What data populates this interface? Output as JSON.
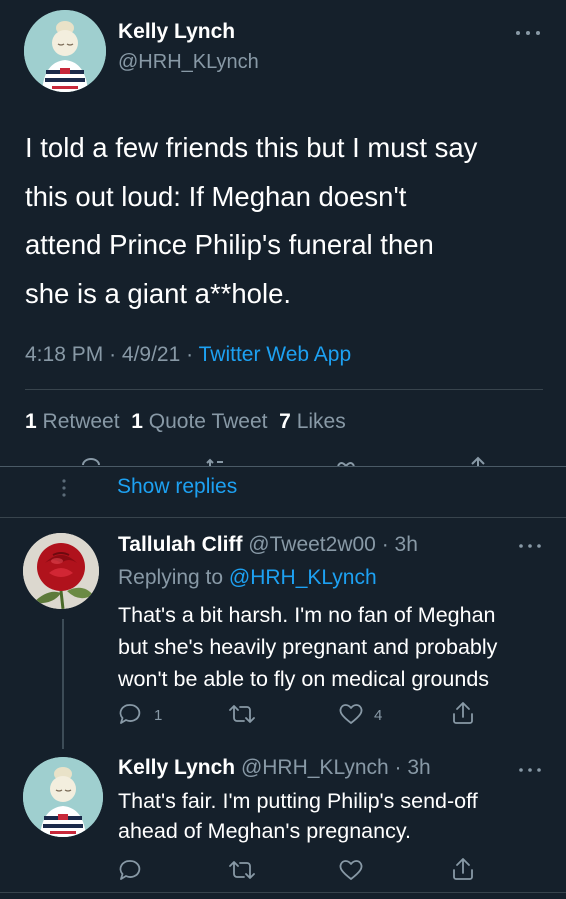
{
  "main_tweet": {
    "author_name": "Kelly Lynch",
    "author_handle": "@HRH_KLynch",
    "text_lines": [
      "I told a few friends this but I must say",
      "this out loud: If Meghan doesn't",
      "attend Prince Philip's funeral then",
      "she is a giant a**hole."
    ],
    "time": "4:18 PM",
    "date": "4/9/21",
    "separator": "·",
    "source": "Twitter Web App",
    "retweets_count": "1",
    "retweets_label": "Retweet",
    "quotes_count": "1",
    "quotes_label": "Quote Tweet",
    "likes_count": "7",
    "likes_label": "Likes"
  },
  "show_replies_label": "Show replies",
  "replies": [
    {
      "author_name": "Tallulah Cliff",
      "author_handle": "@Tweet2w00",
      "time_ago": "3h",
      "replying_to_label": "Replying to",
      "replying_to_handle": "@HRH_KLynch",
      "text_lines": [
        "That's a bit harsh. I'm no fan of Meghan",
        "but she's heavily pregnant and probably",
        "won't be able to fly on medical grounds"
      ],
      "reply_count": "1",
      "retweet_count": "",
      "like_count": "4"
    },
    {
      "author_name": "Kelly Lynch",
      "author_handle": "@HRH_KLynch",
      "time_ago": "3h",
      "text_lines": [
        "That's fair. I'm putting Philip's send-off",
        "ahead of Meghan's pregnancy."
      ]
    }
  ],
  "colors": {
    "background": "#15202b",
    "text": "#ffffff",
    "muted": "#8899a6",
    "link": "#1da1f2",
    "divider": "#38444d"
  },
  "icons": [
    "more-icon",
    "reply-icon",
    "retweet-icon",
    "like-icon",
    "share-icon",
    "thread-dots-icon"
  ]
}
